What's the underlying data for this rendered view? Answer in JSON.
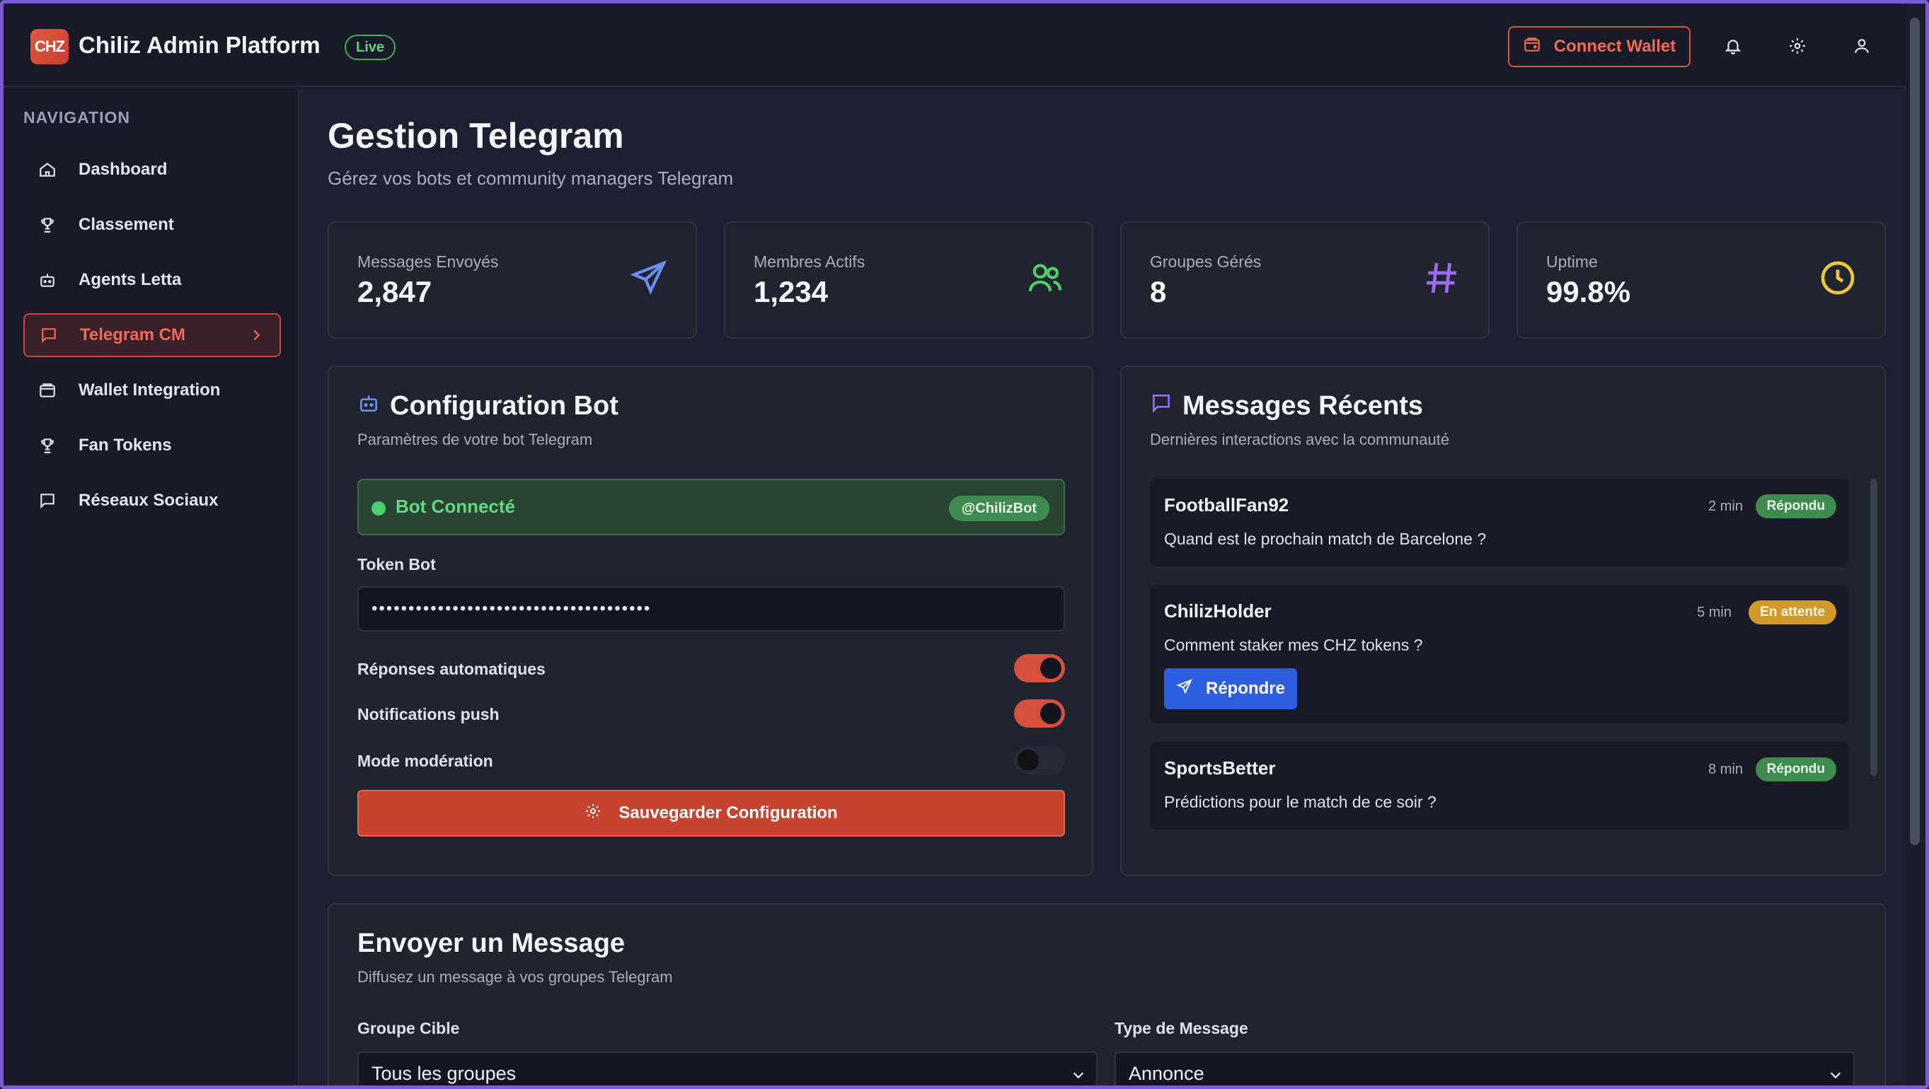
{
  "header": {
    "logo_text": "CHZ",
    "title": "Chiliz Admin Platform",
    "live_badge": "Live",
    "connect_wallet_label": "Connect Wallet",
    "icons": [
      "wallet-icon",
      "bell-icon",
      "gear-icon",
      "user-icon"
    ]
  },
  "sidebar": {
    "heading": "NAVIGATION",
    "items": [
      {
        "label": "Dashboard",
        "icon": "home-icon"
      },
      {
        "label": "Classement",
        "icon": "trophy-icon"
      },
      {
        "label": "Agents Letta",
        "icon": "bot-icon"
      },
      {
        "label": "Telegram CM",
        "icon": "message-icon",
        "active": true
      },
      {
        "label": "Wallet Integration",
        "icon": "wallet-icon"
      },
      {
        "label": "Fan Tokens",
        "icon": "trophy-icon"
      },
      {
        "label": "Réseaux Sociaux",
        "icon": "message-icon"
      }
    ]
  },
  "page": {
    "title": "Gestion Telegram",
    "subtitle": "Gérez vos bots et community managers Telegram"
  },
  "stats": [
    {
      "label": "Messages Envoyés",
      "value": "2,847",
      "icon": "send-icon",
      "color": "#6b8ef0"
    },
    {
      "label": "Membres Actifs",
      "value": "1,234",
      "icon": "users-icon",
      "color": "#4fcf6c"
    },
    {
      "label": "Groupes Gérés",
      "value": "8",
      "icon": "hash-icon",
      "color": "#9b6cf0"
    },
    {
      "label": "Uptime",
      "value": "99.8%",
      "icon": "clock-icon",
      "color": "#f0c63a"
    }
  ],
  "config": {
    "title": "Configuration Bot",
    "subtitle": "Paramètres de votre bot Telegram",
    "bot_status": "Bot Connecté",
    "bot_handle": "@ChilizBot",
    "token_label": "Token Bot",
    "token_value": "••••••••••••••••••••••••••••••••••••••",
    "toggles": [
      {
        "label": "Réponses automatiques",
        "on": true
      },
      {
        "label": "Notifications push",
        "on": true
      },
      {
        "label": "Mode modération",
        "on": false
      }
    ],
    "save_label": "Sauvegarder Configuration"
  },
  "messages": {
    "title": "Messages Récents",
    "subtitle": "Dernières interactions avec la communauté",
    "items": [
      {
        "user": "FootballFan92",
        "time": "2 min",
        "status": "Répondu",
        "text": "Quand est le prochain match de Barcelone ?"
      },
      {
        "user": "ChilizHolder",
        "time": "5 min",
        "status": "En attente",
        "text": "Comment staker mes CHZ tokens ?",
        "reply_label": "Répondre"
      },
      {
        "user": "SportsBetter",
        "time": "8 min",
        "status": "Répondu",
        "text": "Prédictions pour le match de ce soir ?"
      }
    ]
  },
  "send": {
    "title": "Envoyer un Message",
    "subtitle": "Diffusez un message à vos groupes Telegram",
    "group_label": "Groupe Cible",
    "group_value": "Tous les groupes",
    "type_label": "Type de Message",
    "type_value": "Annonce"
  },
  "colors": {
    "accent": "#d5503d",
    "success": "#4fcf6c",
    "warning": "#d19a2a",
    "primary_blue": "#2e5ee0"
  }
}
